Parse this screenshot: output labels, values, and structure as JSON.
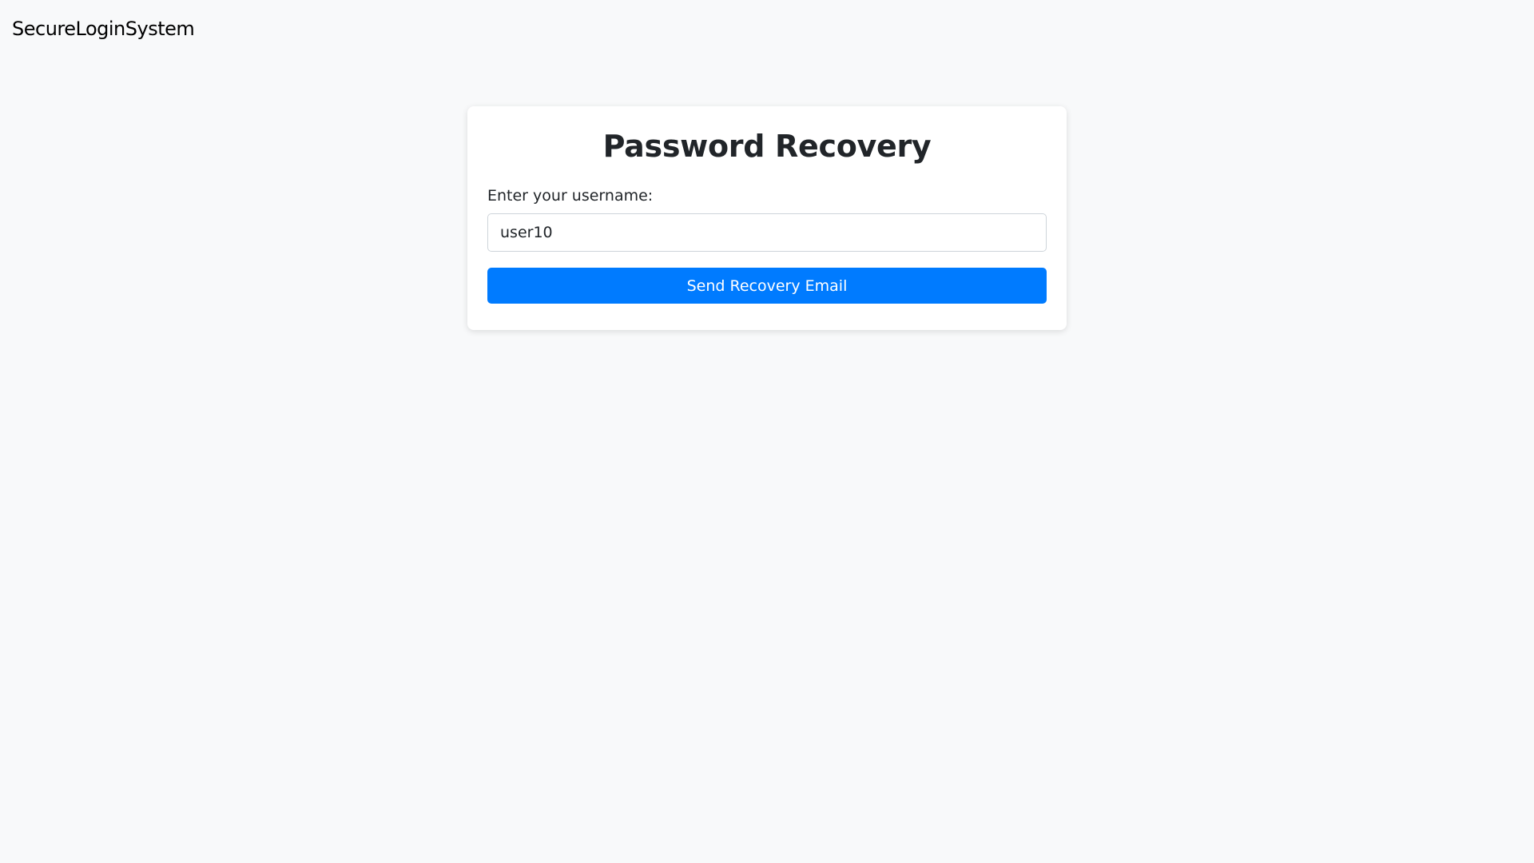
{
  "header": {
    "brand": "SecureLoginSystem"
  },
  "recovery_form": {
    "title": "Password Recovery",
    "username_label": "Enter your username:",
    "username_value": "user10",
    "submit_label": "Send Recovery Email"
  },
  "colors": {
    "background": "#f8f9fa",
    "card": "#ffffff",
    "primary_button": "#007bff",
    "button_text": "#ffffff"
  }
}
